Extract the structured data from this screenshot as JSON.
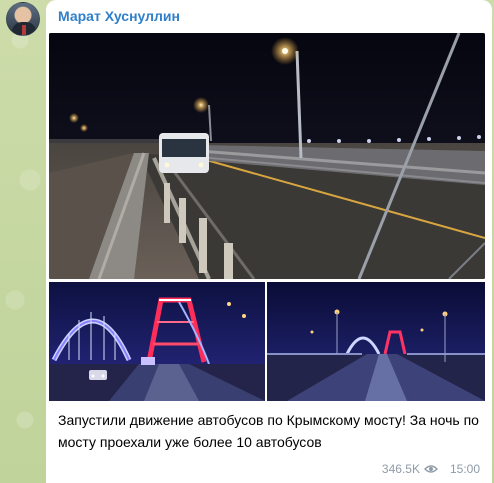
{
  "post": {
    "author": "Марат Хуснуллин",
    "caption": "Запустили движение автобусов по Крымскому мосту! За ночь по мосту проехали уже более 10 автобусов",
    "views": "346.5K",
    "time": "15:00"
  },
  "icons": {
    "views": "eye-icon"
  },
  "colors": {
    "author": "#2f7fc9",
    "meta": "#8e9ca8",
    "background": "#c9d9a8"
  }
}
